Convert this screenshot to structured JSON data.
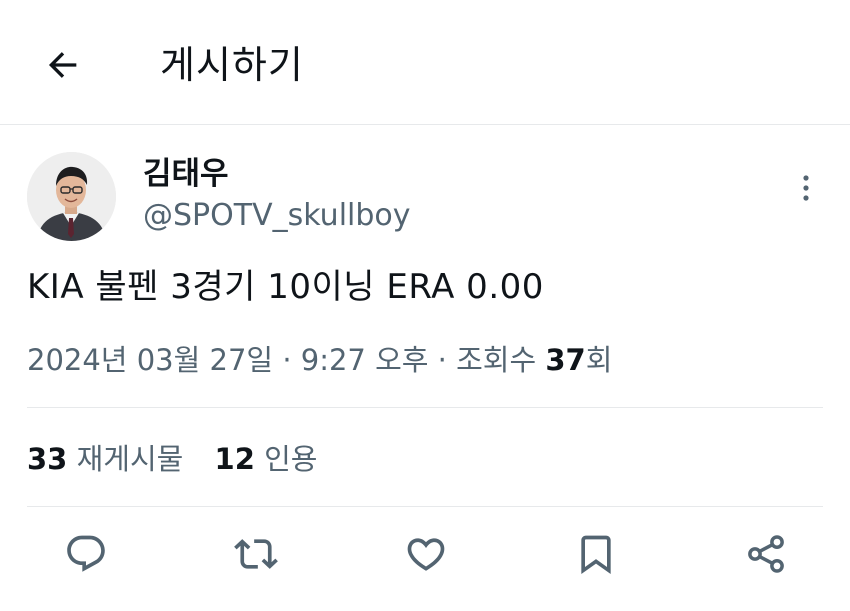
{
  "header": {
    "title": "게시하기",
    "back_icon": "arrow-left-icon"
  },
  "author": {
    "name": "김태우",
    "handle": "@SPOTV_skullboy",
    "avatar_icon": "profile-photo"
  },
  "post": {
    "text": "KIA 불펜 3경기 10이닝 ERA 0.00",
    "date": "2024년 03월 27일",
    "time": "9:27 오후",
    "views_label": "조회수",
    "views_count": "37",
    "views_suffix": "회",
    "separator": "·"
  },
  "stats": {
    "reposts_count": "33",
    "reposts_label": "재게시물",
    "quotes_count": "12",
    "quotes_label": "인용"
  },
  "actions": [
    {
      "icon": "reply-icon"
    },
    {
      "icon": "repost-icon"
    },
    {
      "icon": "like-icon"
    },
    {
      "icon": "bookmark-icon"
    },
    {
      "icon": "share-icon"
    }
  ],
  "colors": {
    "text": "#0f1419",
    "secondary": "#536471",
    "divider": "#e7e9eb",
    "background": "#ffffff"
  }
}
